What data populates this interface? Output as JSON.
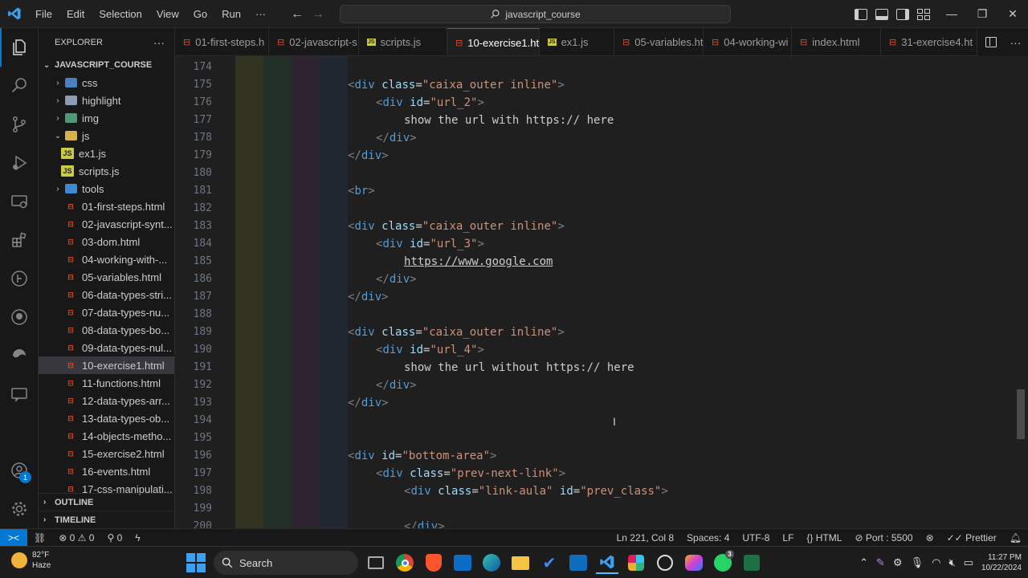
{
  "titlebar": {
    "menu": [
      "File",
      "Edit",
      "Selection",
      "View",
      "Go",
      "Run",
      "···"
    ],
    "search_text": "javascript_course",
    "window_controls": [
      "—",
      "❐",
      "✕"
    ]
  },
  "sidebar": {
    "header": "EXPLORER",
    "more": "···",
    "root": "JAVASCRIPT_COURSE",
    "items": [
      {
        "label": "css",
        "type": "folder",
        "expanded": false,
        "indent": 1,
        "icon": "folder-css-icon"
      },
      {
        "label": "highlight",
        "type": "folder",
        "expanded": false,
        "indent": 1,
        "icon": "folder-icon"
      },
      {
        "label": "img",
        "type": "folder",
        "expanded": false,
        "indent": 1,
        "icon": "folder-images-icon"
      },
      {
        "label": "js",
        "type": "folder",
        "expanded": true,
        "indent": 1,
        "icon": "folder-js-icon"
      },
      {
        "label": "ex1.js",
        "type": "js",
        "indent": 2,
        "icon": "js-file-icon"
      },
      {
        "label": "scripts.js",
        "type": "js",
        "indent": 2,
        "icon": "js-file-icon"
      },
      {
        "label": "tools",
        "type": "folder",
        "expanded": false,
        "indent": 1,
        "icon": "folder-tools-icon"
      },
      {
        "label": "01-first-steps.html",
        "type": "html",
        "indent": 1
      },
      {
        "label": "02-javascript-synt...",
        "type": "html",
        "indent": 1
      },
      {
        "label": "03-dom.html",
        "type": "html",
        "indent": 1
      },
      {
        "label": "04-working-with-...",
        "type": "html",
        "indent": 1
      },
      {
        "label": "05-variables.html",
        "type": "html",
        "indent": 1
      },
      {
        "label": "06-data-types-stri...",
        "type": "html",
        "indent": 1
      },
      {
        "label": "07-data-types-nu...",
        "type": "html",
        "indent": 1
      },
      {
        "label": "08-data-types-bo...",
        "type": "html",
        "indent": 1
      },
      {
        "label": "09-data-types-nul...",
        "type": "html",
        "indent": 1
      },
      {
        "label": "10-exercise1.html",
        "type": "html",
        "indent": 1,
        "selected": true
      },
      {
        "label": "11-functions.html",
        "type": "html",
        "indent": 1
      },
      {
        "label": "12-data-types-arr...",
        "type": "html",
        "indent": 1
      },
      {
        "label": "13-data-types-ob...",
        "type": "html",
        "indent": 1
      },
      {
        "label": "14-objects-metho...",
        "type": "html",
        "indent": 1
      },
      {
        "label": "15-exercise2.html",
        "type": "html",
        "indent": 1
      },
      {
        "label": "16-events.html",
        "type": "html",
        "indent": 1
      },
      {
        "label": "17-css-manipulati...",
        "type": "html",
        "indent": 1
      }
    ],
    "outline": "OUTLINE",
    "timeline": "TIMELINE"
  },
  "tabs": [
    {
      "label": "01-first-steps.h",
      "icon": "html",
      "active": false
    },
    {
      "label": "02-javascript-s",
      "icon": "html",
      "active": false
    },
    {
      "label": "scripts.js",
      "icon": "js",
      "active": false
    },
    {
      "label": "10-exercise1.ht",
      "icon": "html",
      "active": true
    },
    {
      "label": "ex1.js",
      "icon": "js",
      "active": false
    },
    {
      "label": "05-variables.ht",
      "icon": "html",
      "active": false
    },
    {
      "label": "04-working-wi",
      "icon": "html",
      "active": false
    },
    {
      "label": "index.html",
      "icon": "html",
      "active": false
    },
    {
      "label": "31-exercise4.ht",
      "icon": "html",
      "active": false
    }
  ],
  "tab_actions": [
    "split-editor-icon",
    "more-actions-icon"
  ],
  "editor": {
    "lines": [
      {
        "n": "174",
        "indent": 0,
        "tokens": []
      },
      {
        "n": "175",
        "indent": 4,
        "tokens": [
          [
            "tag",
            "<"
          ],
          [
            "tname",
            "div"
          ],
          [
            "txt",
            " "
          ],
          [
            "attr",
            "class"
          ],
          [
            "txt",
            "="
          ],
          [
            "str",
            "\"caixa_outer inline\""
          ],
          [
            "tag",
            ">"
          ]
        ]
      },
      {
        "n": "176",
        "indent": 5,
        "tokens": [
          [
            "tag",
            "<"
          ],
          [
            "tname",
            "div"
          ],
          [
            "txt",
            " "
          ],
          [
            "attr",
            "id"
          ],
          [
            "txt",
            "="
          ],
          [
            "str",
            "\"url_2\""
          ],
          [
            "tag",
            ">"
          ]
        ]
      },
      {
        "n": "177",
        "indent": 6,
        "tokens": [
          [
            "txt",
            "show the url with https:// here"
          ]
        ]
      },
      {
        "n": "178",
        "indent": 5,
        "tokens": [
          [
            "tag",
            "</"
          ],
          [
            "tname",
            "div"
          ],
          [
            "tag",
            ">"
          ]
        ]
      },
      {
        "n": "179",
        "indent": 4,
        "tokens": [
          [
            "tag",
            "</"
          ],
          [
            "tname",
            "div"
          ],
          [
            "tag",
            ">"
          ]
        ]
      },
      {
        "n": "180",
        "indent": 0,
        "tokens": []
      },
      {
        "n": "181",
        "indent": 4,
        "tokens": [
          [
            "tag",
            "<"
          ],
          [
            "tname",
            "br"
          ],
          [
            "tag",
            ">"
          ]
        ]
      },
      {
        "n": "182",
        "indent": 0,
        "tokens": []
      },
      {
        "n": "183",
        "indent": 4,
        "tokens": [
          [
            "tag",
            "<"
          ],
          [
            "tname",
            "div"
          ],
          [
            "txt",
            " "
          ],
          [
            "attr",
            "class"
          ],
          [
            "txt",
            "="
          ],
          [
            "str",
            "\"caixa_outer inline\""
          ],
          [
            "tag",
            ">"
          ]
        ]
      },
      {
        "n": "184",
        "indent": 5,
        "tokens": [
          [
            "tag",
            "<"
          ],
          [
            "tname",
            "div"
          ],
          [
            "txt",
            " "
          ],
          [
            "attr",
            "id"
          ],
          [
            "txt",
            "="
          ],
          [
            "str",
            "\"url_3\""
          ],
          [
            "tag",
            ">"
          ]
        ]
      },
      {
        "n": "185",
        "indent": 6,
        "tokens": [
          [
            "link",
            "https://www.google.com"
          ]
        ]
      },
      {
        "n": "186",
        "indent": 5,
        "tokens": [
          [
            "tag",
            "</"
          ],
          [
            "tname",
            "div"
          ],
          [
            "tag",
            ">"
          ]
        ]
      },
      {
        "n": "187",
        "indent": 4,
        "tokens": [
          [
            "tag",
            "</"
          ],
          [
            "tname",
            "div"
          ],
          [
            "tag",
            ">"
          ]
        ]
      },
      {
        "n": "188",
        "indent": 0,
        "tokens": []
      },
      {
        "n": "189",
        "indent": 4,
        "tokens": [
          [
            "tag",
            "<"
          ],
          [
            "tname",
            "div"
          ],
          [
            "txt",
            " "
          ],
          [
            "attr",
            "class"
          ],
          [
            "txt",
            "="
          ],
          [
            "str",
            "\"caixa_outer inline\""
          ],
          [
            "tag",
            ">"
          ]
        ]
      },
      {
        "n": "190",
        "indent": 5,
        "tokens": [
          [
            "tag",
            "<"
          ],
          [
            "tname",
            "div"
          ],
          [
            "txt",
            " "
          ],
          [
            "attr",
            "id"
          ],
          [
            "txt",
            "="
          ],
          [
            "str",
            "\"url_4\""
          ],
          [
            "tag",
            ">"
          ]
        ]
      },
      {
        "n": "191",
        "indent": 6,
        "tokens": [
          [
            "txt",
            "show the url without https:// here"
          ]
        ]
      },
      {
        "n": "192",
        "indent": 5,
        "tokens": [
          [
            "tag",
            "</"
          ],
          [
            "tname",
            "div"
          ],
          [
            "tag",
            ">"
          ]
        ]
      },
      {
        "n": "193",
        "indent": 4,
        "tokens": [
          [
            "tag",
            "</"
          ],
          [
            "tname",
            "div"
          ],
          [
            "tag",
            ">"
          ]
        ]
      },
      {
        "n": "194",
        "indent": 0,
        "tokens": []
      },
      {
        "n": "195",
        "indent": 0,
        "tokens": []
      },
      {
        "n": "196",
        "indent": 4,
        "tokens": [
          [
            "tag",
            "<"
          ],
          [
            "tname",
            "div"
          ],
          [
            "txt",
            " "
          ],
          [
            "attr",
            "id"
          ],
          [
            "txt",
            "="
          ],
          [
            "str",
            "\"bottom-area\""
          ],
          [
            "tag",
            ">"
          ]
        ]
      },
      {
        "n": "197",
        "indent": 5,
        "tokens": [
          [
            "tag",
            "<"
          ],
          [
            "tname",
            "div"
          ],
          [
            "txt",
            " "
          ],
          [
            "attr",
            "class"
          ],
          [
            "txt",
            "="
          ],
          [
            "str",
            "\"prev-next-link\""
          ],
          [
            "tag",
            ">"
          ]
        ]
      },
      {
        "n": "198",
        "indent": 6,
        "tokens": [
          [
            "tag",
            "<"
          ],
          [
            "tname",
            "div"
          ],
          [
            "txt",
            " "
          ],
          [
            "attr",
            "class"
          ],
          [
            "txt",
            "="
          ],
          [
            "str",
            "\"link-aula\""
          ],
          [
            "txt",
            " "
          ],
          [
            "attr",
            "id"
          ],
          [
            "txt",
            "="
          ],
          [
            "str",
            "\"prev_class\""
          ],
          [
            "tag",
            ">"
          ]
        ]
      },
      {
        "n": "199",
        "indent": 0,
        "tokens": []
      },
      {
        "n": "200",
        "indent": 6,
        "tokens": [
          [
            "tag",
            "</"
          ],
          [
            "tname",
            "div"
          ],
          [
            "tag",
            ">"
          ]
        ]
      }
    ]
  },
  "statusbar": {
    "errors": "0",
    "warnings": "0",
    "ports": "0",
    "position": "Ln 221, Col 8",
    "spaces": "Spaces: 4",
    "encoding": "UTF-8",
    "eol": "LF",
    "language": "HTML",
    "port": "Port : 5500",
    "prettier": "Prettier"
  },
  "taskbar": {
    "temp": "82°F",
    "condition": "Haze",
    "search": "Search",
    "time": "11:27 PM",
    "date": "10/22/2024",
    "whatsapp_badge": "3",
    "account_badge": "1"
  }
}
